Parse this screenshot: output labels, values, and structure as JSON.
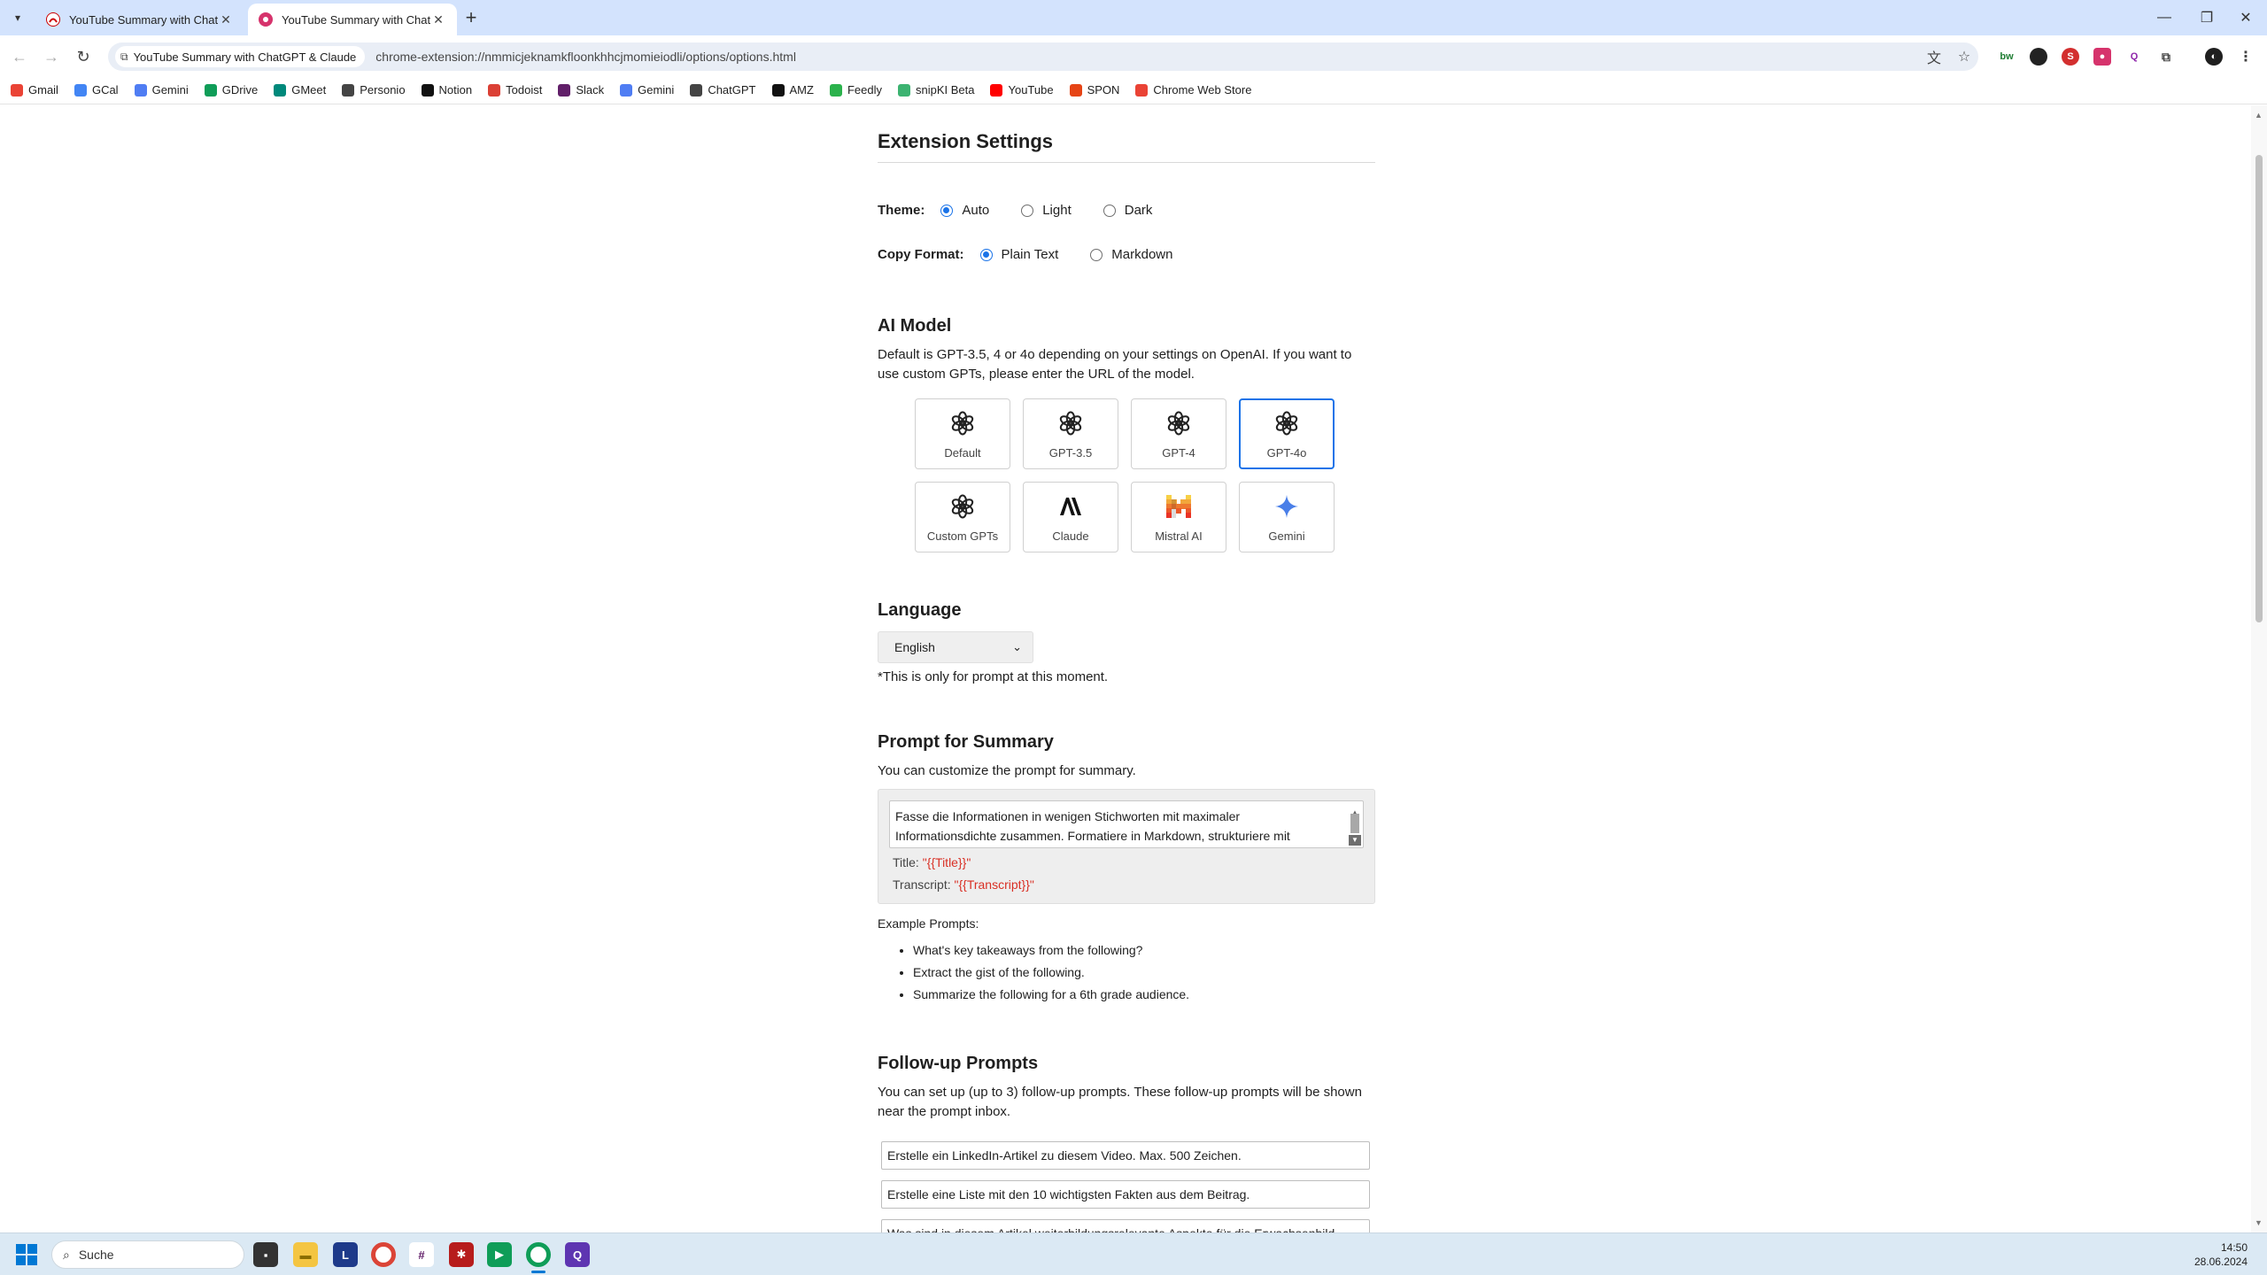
{
  "browser": {
    "tabs": [
      {
        "title": "YouTube Summary with ChatGPT",
        "active": false
      },
      {
        "title": "YouTube Summary with ChatGPT",
        "active": true
      }
    ],
    "new_tab_label": "+",
    "omnibox": {
      "chip_label": "YouTube Summary with ChatGPT & Claude",
      "url": "chrome-extension://nmmicjeknamkfloonkhhcjmomieiodli/options/options.html"
    },
    "bookmarks": [
      {
        "label": "Gmail",
        "icon": "gmail-icon",
        "color": "#ea4335"
      },
      {
        "label": "GCal",
        "icon": "calendar-icon",
        "color": "#4285f4"
      },
      {
        "label": "Gemini",
        "icon": "gemini-icon",
        "color": "#4f7df3"
      },
      {
        "label": "GDrive",
        "icon": "drive-icon",
        "color": "#0f9d58"
      },
      {
        "label": "GMeet",
        "icon": "meet-icon",
        "color": "#00897b"
      },
      {
        "label": "Personio",
        "icon": "personio-icon",
        "color": "#444444"
      },
      {
        "label": "Notion",
        "icon": "notion-icon",
        "color": "#111111"
      },
      {
        "label": "Todoist",
        "icon": "todoist-icon",
        "color": "#db4035"
      },
      {
        "label": "Slack",
        "icon": "slack-icon",
        "color": "#611f69"
      },
      {
        "label": "Gemini",
        "icon": "gemini-icon",
        "color": "#4f7df3"
      },
      {
        "label": "ChatGPT",
        "icon": "chatgpt-icon",
        "color": "#444444"
      },
      {
        "label": "AMZ",
        "icon": "amazon-icon",
        "color": "#111111"
      },
      {
        "label": "Feedly",
        "icon": "feedly-icon",
        "color": "#2bb24c"
      },
      {
        "label": "snipKI Beta",
        "icon": "snipki-icon",
        "color": "#3cb371"
      },
      {
        "label": "YouTube",
        "icon": "youtube-icon",
        "color": "#ff0000"
      },
      {
        "label": "SPON",
        "icon": "spiegel-icon",
        "color": "#e64415"
      },
      {
        "label": "Chrome Web Store",
        "icon": "webstore-icon",
        "color": "#ea4335"
      }
    ]
  },
  "settings": {
    "heading": "Extension Settings",
    "theme": {
      "label": "Theme:",
      "options": [
        "Auto",
        "Light",
        "Dark"
      ],
      "selected": "Auto"
    },
    "copy_format": {
      "label": "Copy Format:",
      "options": [
        "Plain Text",
        "Markdown"
      ],
      "selected": "Plain Text"
    },
    "ai_model": {
      "heading": "AI Model",
      "description": "Default is GPT-3.5, 4 or 4o depending on your settings on OpenAI. If you want to use custom GPTs, please enter the URL of the model.",
      "models": [
        {
          "label": "Default",
          "icon": "openai-icon"
        },
        {
          "label": "GPT-3.5",
          "icon": "openai-icon"
        },
        {
          "label": "GPT-4",
          "icon": "openai-icon"
        },
        {
          "label": "GPT-4o",
          "icon": "openai-icon"
        },
        {
          "label": "Custom GPTs",
          "icon": "openai-icon"
        },
        {
          "label": "Claude",
          "icon": "anthropic-icon"
        },
        {
          "label": "Mistral AI",
          "icon": "mistral-icon"
        },
        {
          "label": "Gemini",
          "icon": "gemini-icon"
        }
      ],
      "selected": "GPT-4o"
    },
    "language": {
      "heading": "Language",
      "selected": "English",
      "note": "*This is only for prompt at this moment."
    },
    "prompt": {
      "heading": "Prompt for Summary",
      "description": "You can customize the prompt for summary.",
      "text": "Fasse die Informationen in wenigen Stichworten mit maximaler Informationsdichte zusammen. Formatiere in Markdown, strukturiere mit",
      "title_label": "Title: ",
      "title_var": "\"{{Title}}\"",
      "transcript_label": "Transcript: ",
      "transcript_var": "\"{{Transcript}}\""
    },
    "examples": {
      "heading": "Example Prompts:",
      "items": [
        "What's key takeaways from the following?",
        "Extract the gist of the following.",
        "Summarize the following for a 6th grade audience."
      ]
    },
    "followup": {
      "heading": "Follow-up Prompts",
      "description": "You can set up (up to 3) follow-up prompts. These follow-up prompts will be shown near the prompt inbox.",
      "prompts": [
        "Erstelle ein LinkedIn-Artikel zu diesem Video. Max. 500 Zeichen.",
        "Erstelle eine Liste mit den 10 wichtigsten Fakten aus dem Beitrag.",
        "Was sind in diesem Artikel weiterbildungsrelevante Aspekte für die Erwachsenbild"
      ]
    }
  },
  "taskbar": {
    "search_placeholder": "Suche",
    "time": "14:50",
    "date": "28.06.2024"
  },
  "colors": {
    "accent": "#1a73e8",
    "tabstrip": "#d3e3fd",
    "taskbar": "#dbe9f4",
    "variable": "#d93025"
  }
}
